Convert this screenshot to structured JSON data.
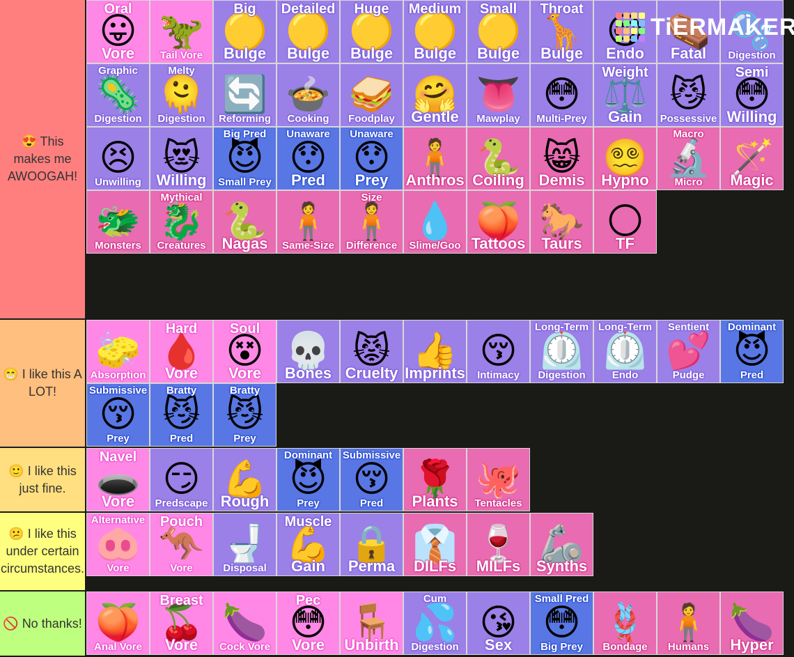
{
  "logo": {
    "text": "TiERMAKER",
    "colors": [
      "#ff7f7f",
      "#ffbf7f",
      "#ffdf7f",
      "#ffff7f",
      "#bfff7f",
      "#7fff7f",
      "#7fffff",
      "#7fbfff",
      "#ff7f7f",
      "#ffbf7f",
      "#ffff7f",
      "#7fff7f",
      "#bfff7f",
      "#ffdf7f",
      "#7fbfff",
      "#bf7fff"
    ]
  },
  "tile_colors": {
    "lp": "#ff88e6",
    "pu": "#9b80e8",
    "bl": "#5877e4",
    "hp": "#e96bb2"
  },
  "tiers": [
    {
      "emoji": "😍",
      "label": "This makes me AWOOGAH!",
      "color": "#ff7f7f",
      "items": [
        {
          "top": "Oral",
          "bottom": "Vore",
          "icon": "😛",
          "c": "lp"
        },
        {
          "top": "",
          "bottom": "Tail Vore",
          "icon": "🦖",
          "c": "lp",
          "bs": 1
        },
        {
          "top": "Big",
          "bottom": "Bulge",
          "icon": "🟡",
          "c": "pu"
        },
        {
          "top": "Detailed",
          "bottom": "Bulge",
          "icon": "🟡",
          "c": "pu"
        },
        {
          "top": "Huge",
          "bottom": "Bulge",
          "icon": "🟡",
          "c": "pu"
        },
        {
          "top": "Medium",
          "bottom": "Bulge",
          "icon": "🟡",
          "c": "pu"
        },
        {
          "top": "Small",
          "bottom": "Bulge",
          "icon": "🟡",
          "c": "pu"
        },
        {
          "top": "Throat",
          "bottom": "Bulge",
          "icon": "🦒",
          "c": "pu"
        },
        {
          "top": "",
          "bottom": "Endo",
          "icon": "😋",
          "c": "pu"
        },
        {
          "top": "",
          "bottom": "Fatal",
          "icon": "⚰️",
          "c": "pu"
        },
        {
          "top": "",
          "bottom": "Digestion",
          "icon": "🫧",
          "c": "pu",
          "bs": 1
        },
        {
          "top": "Graphic",
          "bottom": "Digestion",
          "icon": "🦠",
          "c": "pu",
          "ts": 1,
          "bs": 1
        },
        {
          "top": "Melty",
          "bottom": "Digestion",
          "icon": "🫠",
          "c": "pu",
          "ts": 1,
          "bs": 1
        },
        {
          "top": "",
          "bottom": "Reforming",
          "icon": "🔄",
          "c": "pu",
          "bs": 1
        },
        {
          "top": "",
          "bottom": "Cooking",
          "icon": "🍲",
          "c": "pu",
          "bs": 1
        },
        {
          "top": "",
          "bottom": "Foodplay",
          "icon": "🥪",
          "c": "pu",
          "bs": 1
        },
        {
          "top": "",
          "bottom": "Gentle",
          "icon": "🤗",
          "c": "pu"
        },
        {
          "top": "",
          "bottom": "Mawplay",
          "icon": "👅",
          "c": "pu",
          "bs": 1
        },
        {
          "top": "",
          "bottom": "Multi-Prey",
          "icon": "😳",
          "c": "pu",
          "bs": 1
        },
        {
          "top": "Weight",
          "bottom": "Gain",
          "icon": "⚖️",
          "c": "pu"
        },
        {
          "top": "",
          "bottom": "Possessive",
          "icon": "😼",
          "c": "pu",
          "bs": 1
        },
        {
          "top": "Semi",
          "bottom": "Willing",
          "icon": "😳",
          "c": "pu"
        },
        {
          "top": "",
          "bottom": "Unwilling",
          "icon": "😣",
          "c": "pu",
          "bs": 1
        },
        {
          "top": "",
          "bottom": "Willing",
          "icon": "😻",
          "c": "pu"
        },
        {
          "top": "Big Pred",
          "bottom": "Small Prey",
          "icon": "😈",
          "c": "bl",
          "ts": 1,
          "bs": 1
        },
        {
          "top": "Unaware",
          "bottom": "Pred",
          "icon": "😯",
          "c": "bl",
          "ts": 1
        },
        {
          "top": "Unaware",
          "bottom": "Prey",
          "icon": "😯",
          "c": "bl",
          "ts": 1
        },
        {
          "top": "",
          "bottom": "Anthros",
          "icon": "🧍",
          "c": "hp"
        },
        {
          "top": "",
          "bottom": "Coiling",
          "icon": "🐍",
          "c": "hp"
        },
        {
          "top": "",
          "bottom": "Demis",
          "icon": "😸",
          "c": "hp"
        },
        {
          "top": "",
          "bottom": "Hypno",
          "icon": "😵‍💫",
          "c": "hp"
        },
        {
          "top": "Macro",
          "bottom": "Micro",
          "icon": "🔬",
          "c": "hp",
          "ts": 1,
          "bs": 1
        },
        {
          "top": "",
          "bottom": "Magic",
          "icon": "🪄",
          "c": "hp"
        },
        {
          "top": "",
          "bottom": "Monsters",
          "icon": "🐲",
          "c": "hp",
          "bs": 1
        },
        {
          "top": "Mythical",
          "bottom": "Creatures",
          "icon": "🐉",
          "c": "hp",
          "ts": 1,
          "bs": 1
        },
        {
          "top": "",
          "bottom": "Nagas",
          "icon": "🐍",
          "c": "hp"
        },
        {
          "top": "",
          "bottom": "Same-Size",
          "icon": "🧍",
          "c": "hp",
          "bs": 1
        },
        {
          "top": "Size",
          "bottom": "Difference",
          "icon": "🧍",
          "c": "hp",
          "ts": 1,
          "bs": 1
        },
        {
          "top": "",
          "bottom": "Slime/Goo",
          "icon": "💧",
          "c": "hp",
          "bs": 1
        },
        {
          "top": "",
          "bottom": "Tattoos",
          "icon": "🍑",
          "c": "hp"
        },
        {
          "top": "",
          "bottom": "Taurs",
          "icon": "🐎",
          "c": "hp"
        },
        {
          "top": "",
          "bottom": "TF",
          "icon": "🌕",
          "c": "hp"
        }
      ]
    },
    {
      "emoji": "😁",
      "label": "I like this A LOT!",
      "color": "#ffbf7f",
      "items": [
        {
          "top": "",
          "bottom": "Absorption",
          "icon": "🧽",
          "c": "lp",
          "bs": 1
        },
        {
          "top": "Hard",
          "bottom": "Vore",
          "icon": "🩸",
          "c": "lp"
        },
        {
          "top": "Soul",
          "bottom": "Vore",
          "icon": "😵",
          "c": "lp"
        },
        {
          "top": "",
          "bottom": "Bones",
          "icon": "💀",
          "c": "pu"
        },
        {
          "top": "",
          "bottom": "Cruelty",
          "icon": "😾",
          "c": "pu"
        },
        {
          "top": "",
          "bottom": "Imprints",
          "icon": "👍",
          "c": "pu"
        },
        {
          "top": "",
          "bottom": "Intimacy",
          "icon": "😚",
          "c": "pu",
          "bs": 1
        },
        {
          "top": "Long-Term",
          "bottom": "Digestion",
          "icon": "⏲️",
          "c": "pu",
          "ts": 1,
          "bs": 1
        },
        {
          "top": "Long-Term",
          "bottom": "Endo",
          "icon": "⏲️",
          "c": "pu",
          "ts": 1,
          "bs": 1
        },
        {
          "top": "Sentient",
          "bottom": "Pudge",
          "icon": "💕",
          "c": "pu",
          "ts": 1,
          "bs": 1
        },
        {
          "top": "Dominant",
          "bottom": "Pred",
          "icon": "😈",
          "c": "bl",
          "ts": 1,
          "bs": 1
        },
        {
          "top": "Submissive",
          "bottom": "Prey",
          "icon": "😚",
          "c": "bl",
          "ts": 1,
          "bs": 1
        },
        {
          "top": "Bratty",
          "bottom": "Pred",
          "icon": "😼",
          "c": "bl",
          "ts": 1,
          "bs": 1
        },
        {
          "top": "Bratty",
          "bottom": "Prey",
          "icon": "😼",
          "c": "bl",
          "ts": 1,
          "bs": 1
        }
      ]
    },
    {
      "emoji": "🙂",
      "label": "I like this just fine.",
      "color": "#ffdf7f",
      "items": [
        {
          "top": "Navel",
          "bottom": "Vore",
          "icon": "🕳️",
          "c": "lp"
        },
        {
          "top": "",
          "bottom": "Predscape",
          "icon": "😏",
          "c": "pu",
          "bs": 1
        },
        {
          "top": "",
          "bottom": "Rough",
          "icon": "💪",
          "c": "pu"
        },
        {
          "top": "Dominant",
          "bottom": "Prey",
          "icon": "😈",
          "c": "bl",
          "ts": 1,
          "bs": 1
        },
        {
          "top": "Submissive",
          "bottom": "Pred",
          "icon": "😚",
          "c": "bl",
          "ts": 1,
          "bs": 1
        },
        {
          "top": "",
          "bottom": "Plants",
          "icon": "🌹",
          "c": "hp"
        },
        {
          "top": "",
          "bottom": "Tentacles",
          "icon": "🐙",
          "c": "hp",
          "bs": 1
        }
      ]
    },
    {
      "emoji": "😕",
      "label": "I like this under certain circumstances.",
      "color": "#ffff7f",
      "items": [
        {
          "top": "Alternative",
          "bottom": "Vore",
          "icon": "🐽",
          "c": "lp",
          "ts": 1,
          "bs": 1
        },
        {
          "top": "Pouch",
          "bottom": "Vore",
          "icon": "🦘",
          "c": "lp",
          "bs": 1
        },
        {
          "top": "",
          "bottom": "Disposal",
          "icon": "🚽",
          "c": "pu",
          "bs": 1
        },
        {
          "top": "Muscle",
          "bottom": "Gain",
          "icon": "💪",
          "c": "pu"
        },
        {
          "top": "",
          "bottom": "Perma",
          "icon": "🔒",
          "c": "pu"
        },
        {
          "top": "",
          "bottom": "DILFs",
          "icon": "👔",
          "c": "hp"
        },
        {
          "top": "",
          "bottom": "MILFs",
          "icon": "🍷",
          "c": "hp"
        },
        {
          "top": "",
          "bottom": "Synths",
          "icon": "🦾",
          "c": "hp"
        }
      ]
    },
    {
      "emoji": "🚫",
      "label": "No thanks!",
      "color": "#bfff7f",
      "items": [
        {
          "top": "",
          "bottom": "Anal Vore",
          "icon": "🍑",
          "c": "lp",
          "bs": 1
        },
        {
          "top": "Breast",
          "bottom": "Vore",
          "icon": "🍒",
          "c": "lp"
        },
        {
          "top": "",
          "bottom": "Cock Vore",
          "icon": "🍆",
          "c": "lp",
          "bs": 1
        },
        {
          "top": "Pec",
          "bottom": "Vore",
          "icon": "😳",
          "c": "lp"
        },
        {
          "top": "",
          "bottom": "Unbirth",
          "icon": "🪑",
          "c": "lp"
        },
        {
          "top": "Cum",
          "bottom": "Digestion",
          "icon": "💦",
          "c": "pu",
          "ts": 1,
          "bs": 1
        },
        {
          "top": "",
          "bottom": "Sex",
          "icon": "😘",
          "c": "pu"
        },
        {
          "top": "Small Pred",
          "bottom": "Big Prey",
          "icon": "😳",
          "c": "bl",
          "ts": 1,
          "bs": 1
        },
        {
          "top": "",
          "bottom": "Bondage",
          "icon": "🪢",
          "c": "hp",
          "bs": 1
        },
        {
          "top": "",
          "bottom": "Humans",
          "icon": "🧍",
          "c": "hp",
          "bs": 1
        },
        {
          "top": "",
          "bottom": "Hyper",
          "icon": "🍆",
          "c": "hp"
        }
      ]
    }
  ]
}
